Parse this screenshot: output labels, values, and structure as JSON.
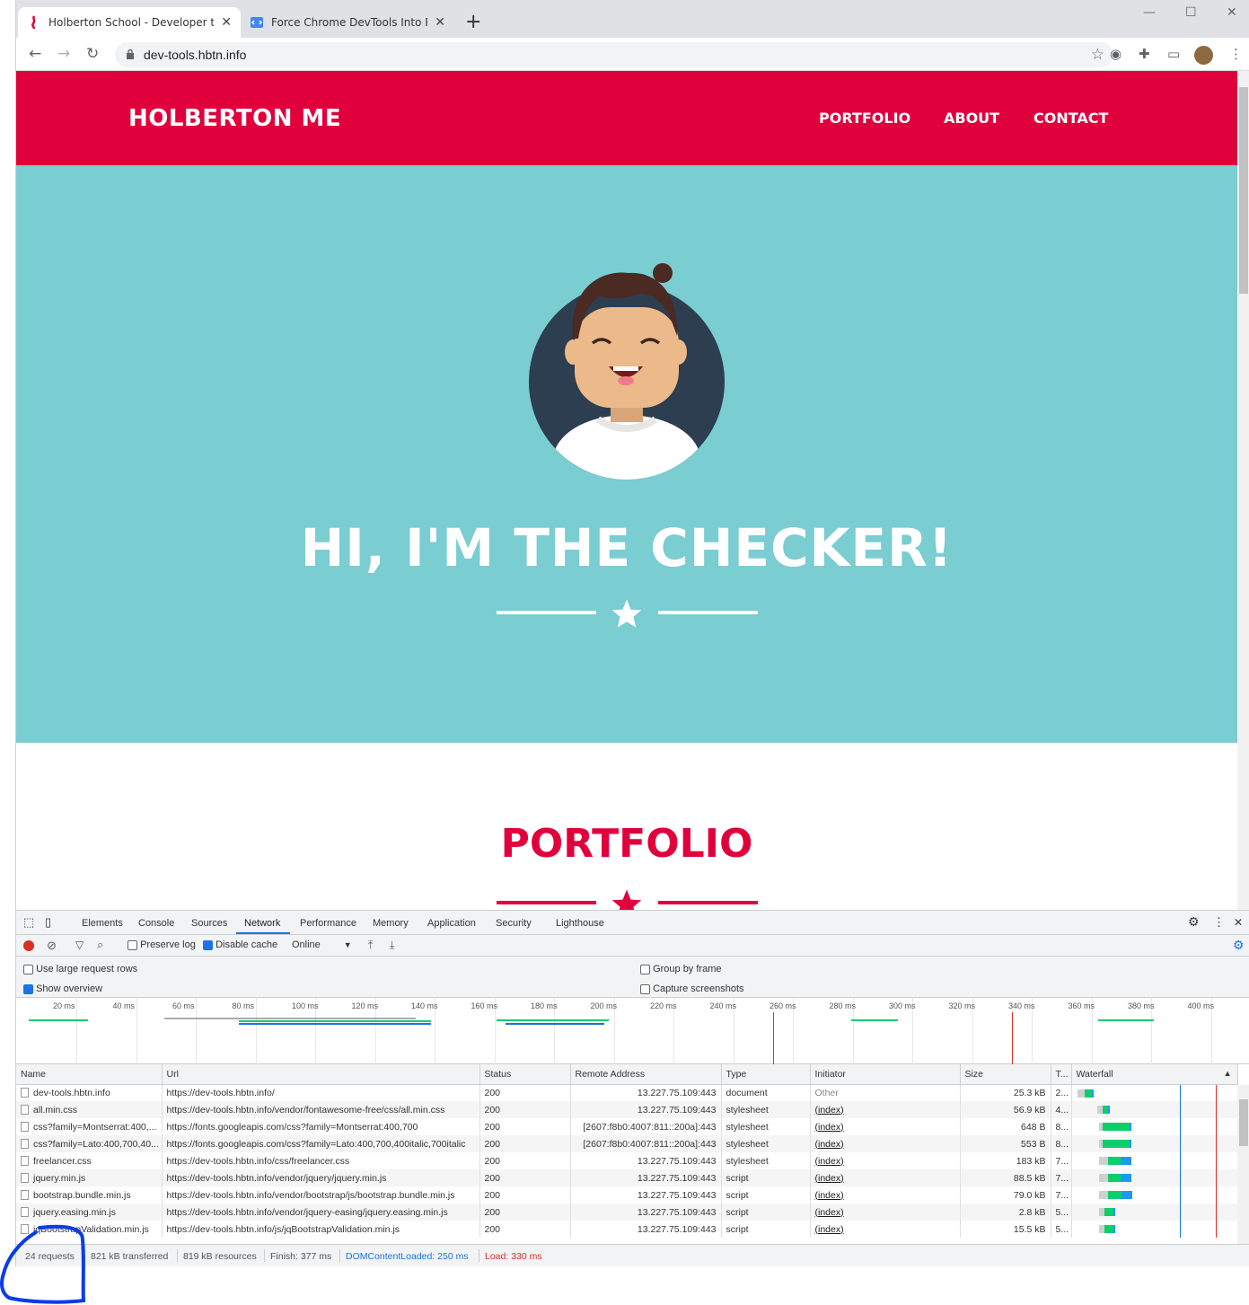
{
  "browser": {
    "tabs": [
      {
        "title": "Holberton School - Developer to",
        "active": true
      },
      {
        "title": "Force Chrome DevTools Into Prin",
        "active": false
      }
    ],
    "address": "dev-tools.hbtn.info"
  },
  "site": {
    "brand": "HOLBERTON ME",
    "nav": [
      "PORTFOLIO",
      "ABOUT",
      "CONTACT"
    ],
    "hero_title": "HI, I'M THE CHECKER!",
    "section_title": "PORTFOLIO",
    "colors": {
      "primary": "#e0003c",
      "hero_bg": "#7acdd1",
      "avatar_bg": "#2c3e50"
    }
  },
  "devtools": {
    "tabs": [
      "Elements",
      "Console",
      "Sources",
      "Network",
      "Performance",
      "Memory",
      "Application",
      "Security",
      "Lighthouse"
    ],
    "active_tab": "Network",
    "toolbar": {
      "preserve_log": "Preserve log",
      "disable_cache": "Disable cache",
      "throttle": "Online"
    },
    "settings": {
      "large_rows": "Use large request rows",
      "show_overview": "Show overview",
      "group_by_frame": "Group by frame",
      "capture_screenshots": "Capture screenshots"
    },
    "timeline_ticks": [
      "20 ms",
      "40 ms",
      "60 ms",
      "80 ms",
      "100 ms",
      "120 ms",
      "140 ms",
      "160 ms",
      "180 ms",
      "200 ms",
      "220 ms",
      "240 ms",
      "260 ms",
      "280 ms",
      "300 ms",
      "320 ms",
      "340 ms",
      "360 ms",
      "380 ms",
      "400 ms"
    ],
    "columns": [
      "Name",
      "Url",
      "Status",
      "Remote Address",
      "Type",
      "Initiator",
      "Size",
      "T...",
      "Waterfall"
    ],
    "requests": [
      {
        "name": "dev-tools.hbtn.info",
        "url": "https://dev-tools.hbtn.info/",
        "status": "200",
        "remote": "13.227.75.109:443",
        "type": "document",
        "initiator": "Other",
        "size": "25.3 kB",
        "time": "2..."
      },
      {
        "name": "all.min.css",
        "url": "https://dev-tools.hbtn.info/vendor/fontawesome-free/css/all.min.css",
        "status": "200",
        "remote": "13.227.75.109:443",
        "type": "stylesheet",
        "initiator": "(index)",
        "size": "56.9 kB",
        "time": "4..."
      },
      {
        "name": "css?family=Montserrat:400,...",
        "url": "https://fonts.googleapis.com/css?family=Montserrat:400,700",
        "status": "200",
        "remote": "[2607:f8b0:4007:811::200a]:443",
        "type": "stylesheet",
        "initiator": "(index)",
        "size": "648 B",
        "time": "8..."
      },
      {
        "name": "css?family=Lato:400,700,40...",
        "url": "https://fonts.googleapis.com/css?family=Lato:400,700,400italic,700italic",
        "status": "200",
        "remote": "[2607:f8b0:4007:811::200a]:443",
        "type": "stylesheet",
        "initiator": "(index)",
        "size": "553 B",
        "time": "8..."
      },
      {
        "name": "freelancer.css",
        "url": "https://dev-tools.hbtn.info/css/freelancer.css",
        "status": "200",
        "remote": "13.227.75.109:443",
        "type": "stylesheet",
        "initiator": "(index)",
        "size": "183 kB",
        "time": "7..."
      },
      {
        "name": "jquery.min.js",
        "url": "https://dev-tools.hbtn.info/vendor/jquery/jquery.min.js",
        "status": "200",
        "remote": "13.227.75.109:443",
        "type": "script",
        "initiator": "(index)",
        "size": "88.5 kB",
        "time": "7..."
      },
      {
        "name": "bootstrap.bundle.min.js",
        "url": "https://dev-tools.hbtn.info/vendor/bootstrap/js/bootstrap.bundle.min.js",
        "status": "200",
        "remote": "13.227.75.109:443",
        "type": "script",
        "initiator": "(index)",
        "size": "79.0 kB",
        "time": "7..."
      },
      {
        "name": "jquery.easing.min.js",
        "url": "https://dev-tools.hbtn.info/vendor/jquery-easing/jquery.easing.min.js",
        "status": "200",
        "remote": "13.227.75.109:443",
        "type": "script",
        "initiator": "(index)",
        "size": "2.8 kB",
        "time": "5..."
      },
      {
        "name": "jqBootstrapValidation.min.js",
        "url": "https://dev-tools.hbtn.info/js/jqBootstrapValidation.min.js",
        "status": "200",
        "remote": "13.227.75.109:443",
        "type": "script",
        "initiator": "(index)",
        "size": "15.5 kB",
        "time": "5..."
      }
    ],
    "summary": {
      "requests": "24 requests",
      "transferred": "821 kB transferred",
      "resources": "819 kB resources",
      "finish": "Finish: 377 ms",
      "dcl": "DOMContentLoaded: 250 ms",
      "load": "Load: 330 ms"
    }
  }
}
